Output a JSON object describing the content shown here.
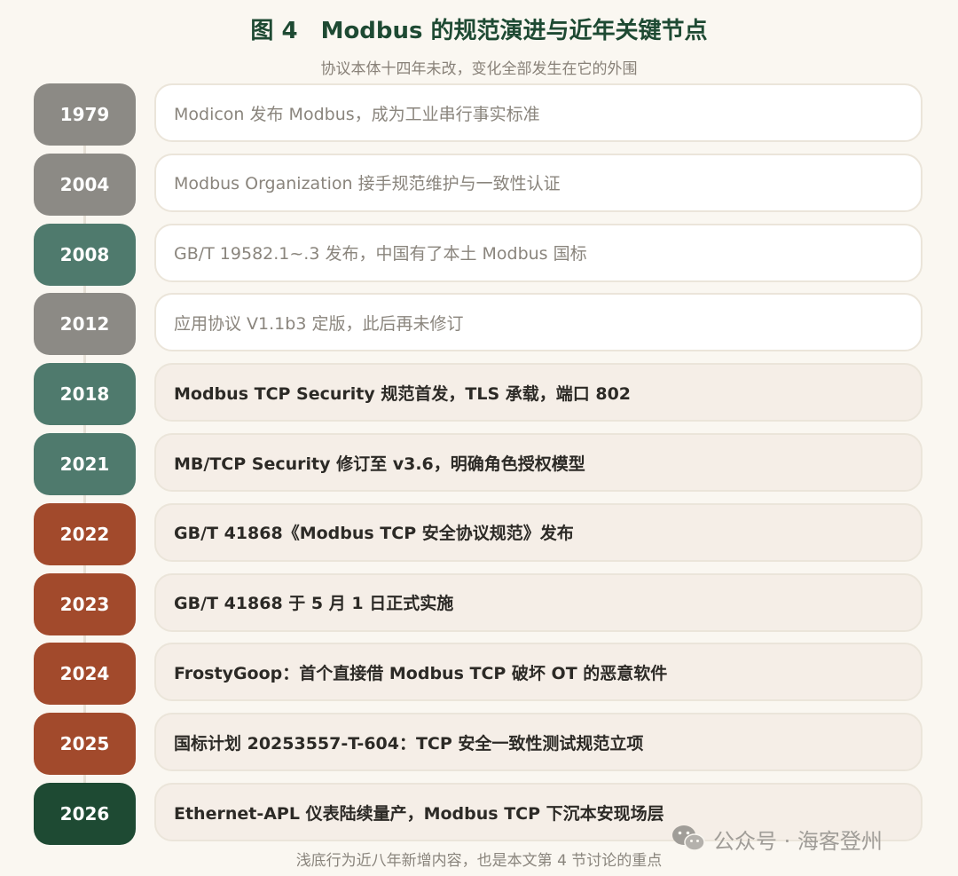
{
  "title": "图 4　Modbus 的规范演进与近年关键节点",
  "subtitle": "协议本体十四年未改，变化全部发生在它的外围",
  "colors": {
    "gray": "#8c8a85",
    "teal": "#4f7a6d",
    "rust": "#a24a2c",
    "dark_green": "#1e4a33",
    "card_plain_bg": "#ffffff",
    "card_highlight_bg": "#f5eee7"
  },
  "events": [
    {
      "year": "1979",
      "text": "Modicon 发布 Modbus，成为工业串行事实标准",
      "color": "#8c8a85",
      "highlight": false
    },
    {
      "year": "2004",
      "text": "Modbus Organization 接手规范维护与一致性认证",
      "color": "#8c8a85",
      "highlight": false
    },
    {
      "year": "2008",
      "text": "GB/T 19582.1~.3 发布，中国有了本土 Modbus 国标",
      "color": "#4f7a6d",
      "highlight": false
    },
    {
      "year": "2012",
      "text": "应用协议 V1.1b3 定版，此后再未修订",
      "color": "#8c8a85",
      "highlight": false
    },
    {
      "year": "2018",
      "text": "Modbus TCP Security 规范首发，TLS 承载，端口 802",
      "color": "#4f7a6d",
      "highlight": true
    },
    {
      "year": "2021",
      "text": "MB/TCP Security 修订至 v3.6，明确角色授权模型",
      "color": "#4f7a6d",
      "highlight": true
    },
    {
      "year": "2022",
      "text": "GB/T 41868《Modbus TCP 安全协议规范》发布",
      "color": "#a24a2c",
      "highlight": true
    },
    {
      "year": "2023",
      "text": "GB/T 41868 于 5 月 1 日正式实施",
      "color": "#a24a2c",
      "highlight": true
    },
    {
      "year": "2024",
      "text": "FrostyGoop：首个直接借 Modbus TCP 破坏 OT 的恶意软件",
      "color": "#a24a2c",
      "highlight": true
    },
    {
      "year": "2025",
      "text": "国标计划 20253557-T-604：TCP 安全一致性测试规范立项",
      "color": "#a24a2c",
      "highlight": true
    },
    {
      "year": "2026",
      "text": "Ethernet-APL 仪表陆续量产，Modbus TCP 下沉本安现场层",
      "color": "#1e4a33",
      "highlight": true
    }
  ],
  "footnote": "浅底行为近八年新增内容，也是本文第 4 节讨论的重点",
  "watermark": {
    "icon": "wechat-icon",
    "text": "公众号 · 海客登州"
  }
}
